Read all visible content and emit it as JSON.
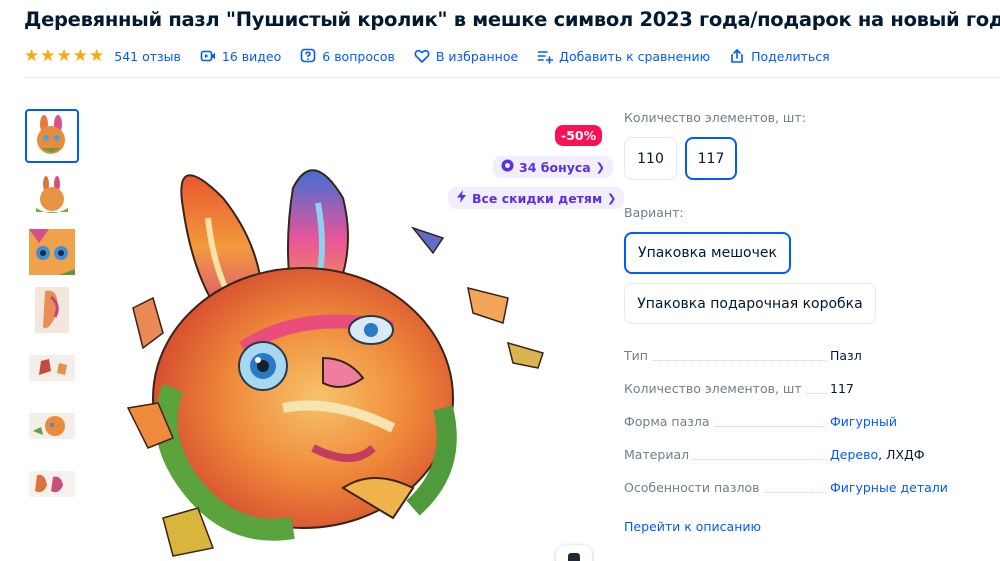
{
  "product": {
    "title": "Деревянный пазл \"Пушистый кролик\" в мешке символ 2023 года/подарок на новый год",
    "rating_stars": 5,
    "reviews": "541 отзыв",
    "videos": "16 видео",
    "questions": "6 вопросов",
    "favorites": "В избранное",
    "compare": "Добавить к сравнению",
    "share": "Поделиться"
  },
  "badges": {
    "sale": "-50%",
    "bonus": "34 бонуса",
    "kids": "Все скидки детям"
  },
  "options": {
    "count_label": "Количество элементов, шт:",
    "counts": [
      "110",
      "117"
    ],
    "count_selected": "117",
    "variant_label": "Вариант:",
    "variants": [
      "Упаковка мешочек",
      "Упаковка подарочная коробка"
    ],
    "variant_selected": "Упаковка мешочек"
  },
  "specs": [
    {
      "key": "Тип",
      "value": "Пазл"
    },
    {
      "key": "Количество элементов, шт",
      "value": "117"
    },
    {
      "key": "Форма пазла",
      "value": "Фигурный"
    },
    {
      "key": "Материал",
      "value": "Дерево",
      "value2": ", ЛХДФ"
    },
    {
      "key": "Особенности пазлов",
      "value": "Фигурные детали"
    }
  ],
  "goto_description": "Перейти к описанию",
  "colors": {
    "accent": "#005bff",
    "sale": "#f91155",
    "bonus_bg": "#f1eefe",
    "bonus_text": "#5c2ee6",
    "star": "#ffa800"
  },
  "gallery": {
    "thumbnail_count": 7,
    "active_index": 0
  }
}
